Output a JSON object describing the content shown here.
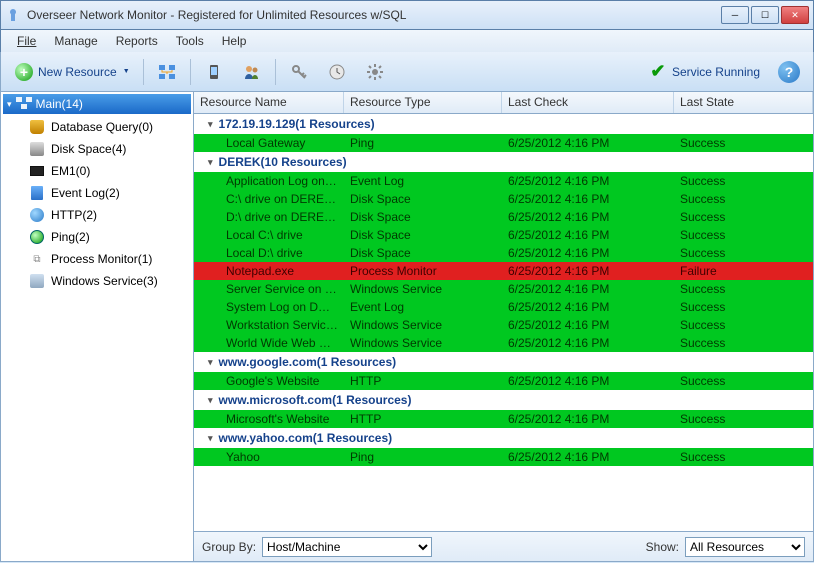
{
  "window": {
    "title": "Overseer Network Monitor - Registered for Unlimited Resources w/SQL"
  },
  "menu": {
    "file": "File",
    "manage": "Manage",
    "reports": "Reports",
    "tools": "Tools",
    "help": "Help"
  },
  "toolbar": {
    "new_resource": "New Resource",
    "service_running": "Service Running"
  },
  "sidebar": {
    "root": "Main(14)",
    "items": [
      {
        "label": "Database Query(0)",
        "icon": "database-icon"
      },
      {
        "label": "Disk Space(4)",
        "icon": "disk-icon"
      },
      {
        "label": "EM1(0)",
        "icon": "em1-icon"
      },
      {
        "label": "Event Log(2)",
        "icon": "eventlog-icon"
      },
      {
        "label": "HTTP(2)",
        "icon": "http-icon"
      },
      {
        "label": "Ping(2)",
        "icon": "ping-icon"
      },
      {
        "label": "Process Monitor(1)",
        "icon": "process-icon"
      },
      {
        "label": "Windows Service(3)",
        "icon": "winservice-icon"
      }
    ]
  },
  "grid": {
    "columns": {
      "name": "Resource Name",
      "type": "Resource Type",
      "check": "Last Check",
      "state": "Last State"
    },
    "groups": [
      {
        "title": "172.19.19.129(1 Resources)",
        "rows": [
          {
            "name": "Local Gateway",
            "type": "Ping",
            "check": "6/25/2012 4:16 PM",
            "state": "Success",
            "status": "success"
          }
        ]
      },
      {
        "title": "DEREK(10 Resources)",
        "rows": [
          {
            "name": "Application Log on DEREK",
            "type": "Event Log",
            "check": "6/25/2012 4:16 PM",
            "state": "Success",
            "status": "success"
          },
          {
            "name": "C:\\ drive on DEREK via ...",
            "type": "Disk Space",
            "check": "6/25/2012 4:16 PM",
            "state": "Success",
            "status": "success"
          },
          {
            "name": "D:\\ drive on DEREK via ...",
            "type": "Disk Space",
            "check": "6/25/2012 4:16 PM",
            "state": "Success",
            "status": "success"
          },
          {
            "name": "Local C:\\ drive",
            "type": "Disk Space",
            "check": "6/25/2012 4:16 PM",
            "state": "Success",
            "status": "success"
          },
          {
            "name": "Local D:\\ drive",
            "type": "Disk Space",
            "check": "6/25/2012 4:16 PM",
            "state": "Success",
            "status": "success"
          },
          {
            "name": "Notepad.exe",
            "type": "Process Monitor",
            "check": "6/25/2012 4:16 PM",
            "state": "Failure",
            "status": "failure"
          },
          {
            "name": "Server Service on DEREK",
            "type": "Windows Service",
            "check": "6/25/2012 4:16 PM",
            "state": "Success",
            "status": "success"
          },
          {
            "name": "System Log on DEREK",
            "type": "Event Log",
            "check": "6/25/2012 4:16 PM",
            "state": "Success",
            "status": "success"
          },
          {
            "name": "Workstation Service on...",
            "type": "Windows Service",
            "check": "6/25/2012 4:16 PM",
            "state": "Success",
            "status": "success"
          },
          {
            "name": "World Wide Web Servic...",
            "type": "Windows Service",
            "check": "6/25/2012 4:16 PM",
            "state": "Success",
            "status": "success"
          }
        ]
      },
      {
        "title": "www.google.com(1 Resources)",
        "rows": [
          {
            "name": "Google's Website",
            "type": "HTTP",
            "check": "6/25/2012 4:16 PM",
            "state": "Success",
            "status": "success"
          }
        ]
      },
      {
        "title": "www.microsoft.com(1 Resources)",
        "rows": [
          {
            "name": "Microsoft's Website",
            "type": "HTTP",
            "check": "6/25/2012 4:16 PM",
            "state": "Success",
            "status": "success"
          }
        ]
      },
      {
        "title": "www.yahoo.com(1 Resources)",
        "rows": [
          {
            "name": "Yahoo",
            "type": "Ping",
            "check": "6/25/2012 4:16 PM",
            "state": "Success",
            "status": "success"
          }
        ]
      }
    ]
  },
  "bottombar": {
    "group_by_label": "Group By:",
    "group_by_value": "Host/Machine",
    "show_label": "Show:",
    "show_value": "All Resources"
  }
}
